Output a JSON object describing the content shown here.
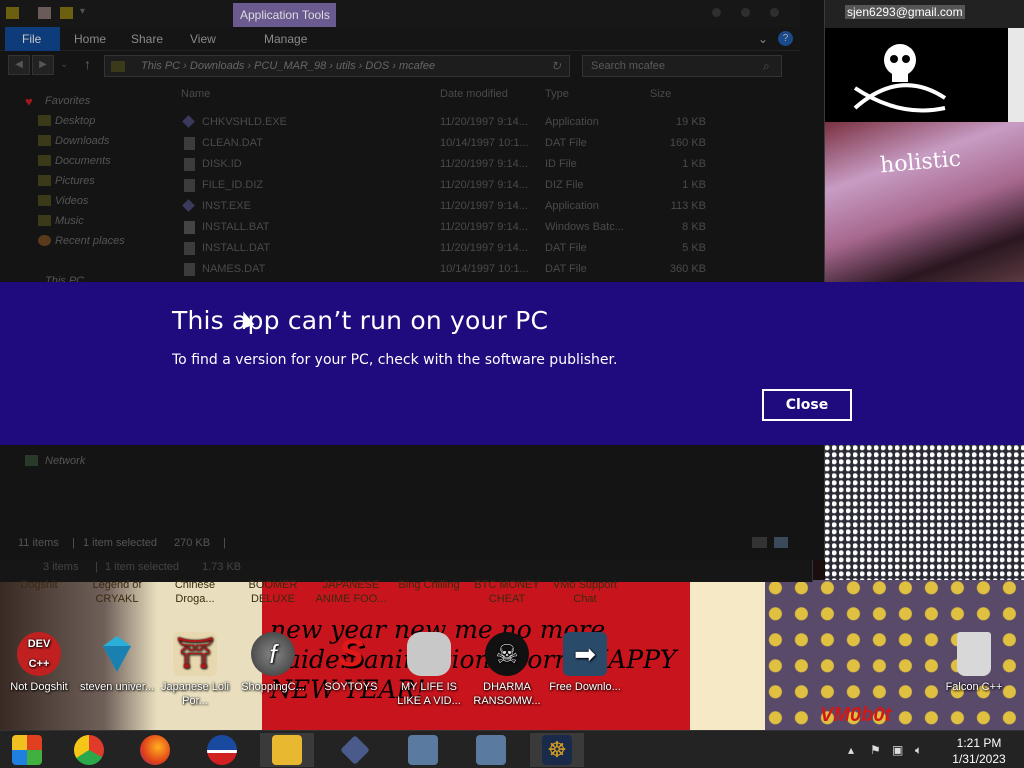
{
  "wallpaper": {
    "email": "sjen6293@gmail.com",
    "pink_text": "holistic",
    "red_text": "new year new me no more haiden animations porn. HAPPY NEW YEAR!",
    "vm_text": "VM0b0t"
  },
  "explorer": {
    "title_tool": "Application Tools",
    "tabs": {
      "file": "File",
      "home": "Home",
      "share": "Share",
      "view": "View",
      "manage": "Manage"
    },
    "breadcrumb": [
      "This PC",
      "Downloads",
      "PCU_MAR_98",
      "utils",
      "DOS",
      "mcafee"
    ],
    "search_placeholder": "Search mcafee",
    "nav": [
      {
        "label": "Favorites"
      },
      {
        "label": "Desktop"
      },
      {
        "label": "Downloads"
      },
      {
        "label": "Documents"
      },
      {
        "label": "Pictures"
      },
      {
        "label": "Videos"
      },
      {
        "label": "Music"
      },
      {
        "label": "Recent places"
      },
      {
        "label": "This PC"
      },
      {
        "label": "Network"
      }
    ],
    "columns": {
      "name": "Name",
      "date": "Date modified",
      "type": "Type",
      "size": "Size"
    },
    "files": [
      {
        "name": "CHKVSHLD.EXE",
        "date": "11/20/1997 9:14...",
        "type": "Application",
        "size": "19 KB"
      },
      {
        "name": "CLEAN.DAT",
        "date": "10/14/1997 10:1...",
        "type": "DAT File",
        "size": "160 KB"
      },
      {
        "name": "DISK.ID",
        "date": "11/20/1997 9:14...",
        "type": "ID File",
        "size": "1 KB"
      },
      {
        "name": "FILE_ID.DIZ",
        "date": "11/20/1997 9:14...",
        "type": "DIZ File",
        "size": "1 KB"
      },
      {
        "name": "INST.EXE",
        "date": "11/20/1997 9:14...",
        "type": "Application",
        "size": "113 KB"
      },
      {
        "name": "INSTALL.BAT",
        "date": "11/20/1997 9:14...",
        "type": "Windows Batc...",
        "size": "8 KB"
      },
      {
        "name": "INSTALL.DAT",
        "date": "11/20/1997 9:14...",
        "type": "DAT File",
        "size": "5 KB"
      },
      {
        "name": "NAMES.DAT",
        "date": "10/14/1997 10:1...",
        "type": "DAT File",
        "size": "360 KB"
      }
    ],
    "status": {
      "items": "11 items",
      "selected": "1 item selected",
      "size": "270 KB"
    },
    "status_back": {
      "items": "3 items",
      "selected": "1 item selected",
      "size": "1.73 KB"
    }
  },
  "dialog": {
    "title": "This app can’t run on your PC",
    "message": "To find a version for your PC, check with the software publisher.",
    "close_label": "Close",
    "bg_color": "#1f0b7d"
  },
  "desktop": {
    "top_labels": [
      "Dogshit",
      "Legend of CRYAKL",
      "Chinese Droga...",
      "BOOMER DELUXE",
      "JAPANESE ANIME FOO...",
      "Bing Chilling",
      "BTC MONEY CHEAT",
      "VMo Support Chat"
    ],
    "icons": [
      {
        "label": "Not Dogshit",
        "icon": "dev-cpp-icon"
      },
      {
        "label": "steven univer...",
        "icon": "diamond-icon"
      },
      {
        "label": "Japanese Loli Por...",
        "icon": "torii-icon"
      },
      {
        "label": "ShoppingC...",
        "icon": "flash-icon"
      },
      {
        "label": "SOYTOYS",
        "icon": "s-logo-icon"
      },
      {
        "label": "MY LIFE IS LIKE A VID...",
        "icon": "gamepad-icon"
      },
      {
        "label": "DHARMA RANSOMW...",
        "icon": "skull-icon"
      },
      {
        "label": "Free Downlo...",
        "icon": "arrow-icon"
      },
      {
        "label": "Falcon C++",
        "icon": "recycle-bin-icon"
      }
    ]
  },
  "taskbar": {
    "time": "1:21 PM",
    "date": "1/31/2023"
  }
}
